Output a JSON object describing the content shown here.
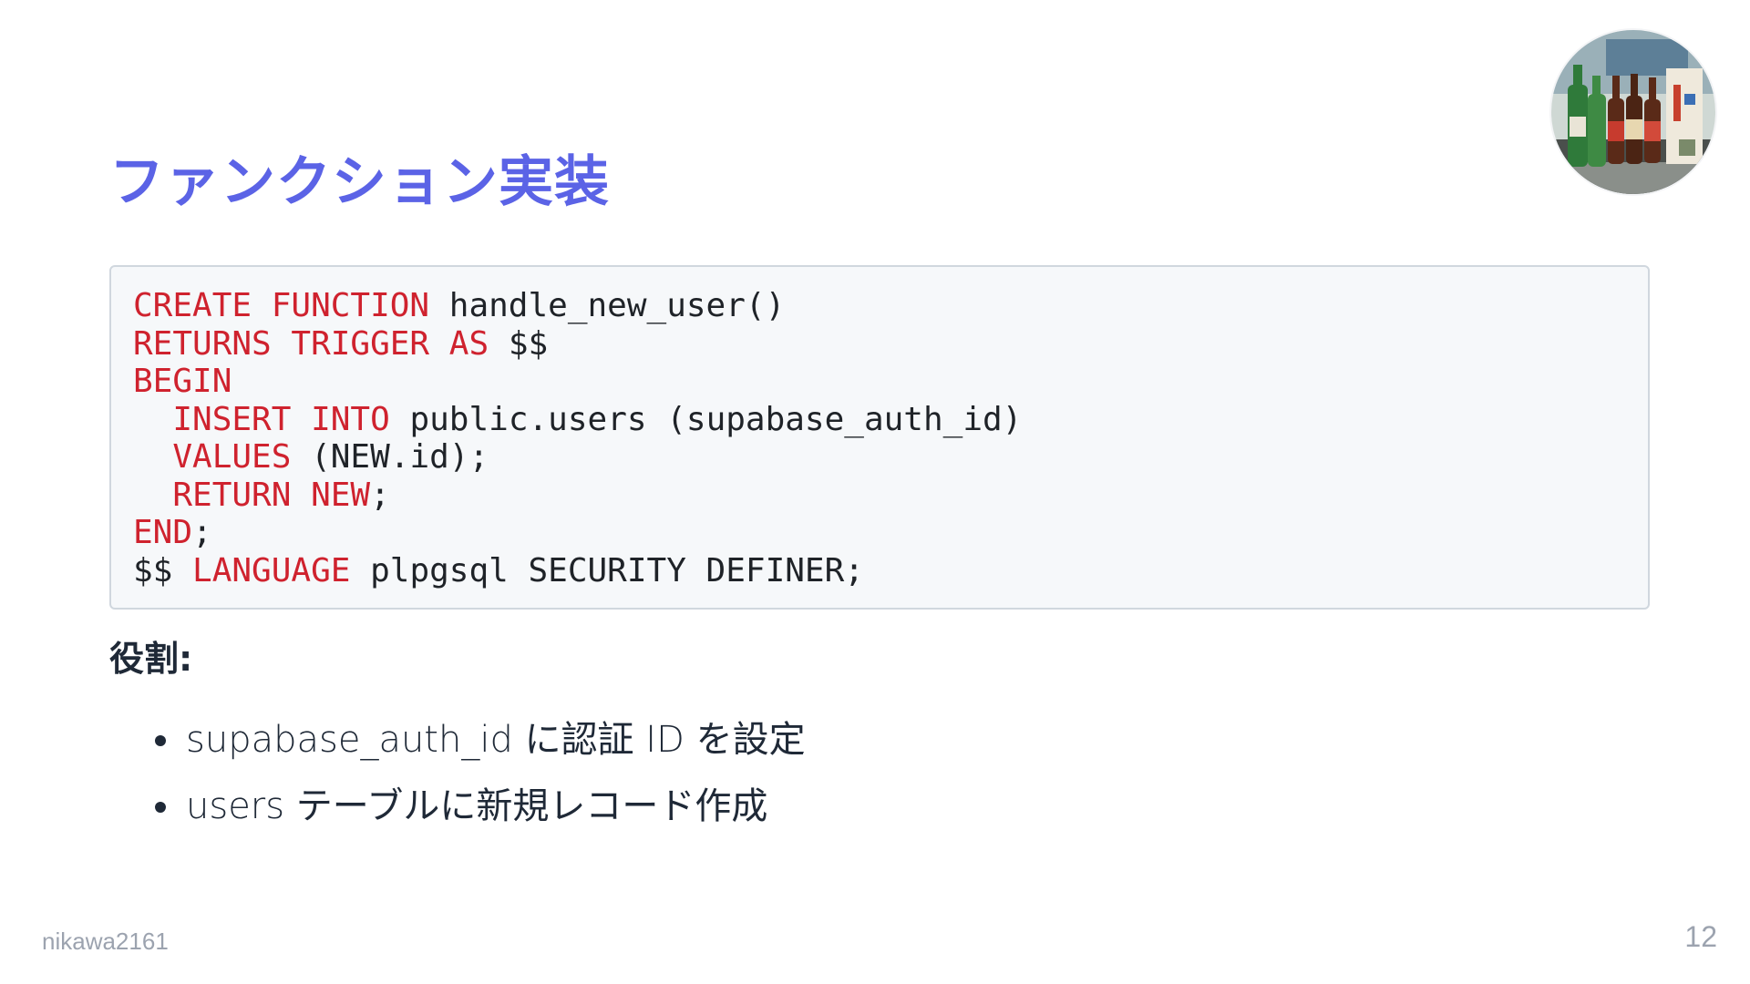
{
  "slide": {
    "title": "ファンクション実装",
    "code_lines": [
      [
        {
          "t": "CREATE FUNCTION",
          "k": true
        },
        {
          "t": " handle_new_user()",
          "k": false
        }
      ],
      [
        {
          "t": "RETURNS TRIGGER AS",
          "k": true
        },
        {
          "t": " $$",
          "k": false
        }
      ],
      [
        {
          "t": "BEGIN",
          "k": true
        }
      ],
      [
        {
          "t": "  ",
          "k": false
        },
        {
          "t": "INSERT INTO",
          "k": true
        },
        {
          "t": " public.users (supabase_auth_id)",
          "k": false
        }
      ],
      [
        {
          "t": "  ",
          "k": false
        },
        {
          "t": "VALUES",
          "k": true
        },
        {
          "t": " (NEW.id);",
          "k": false
        }
      ],
      [
        {
          "t": "  ",
          "k": false
        },
        {
          "t": "RETURN NEW",
          "k": true
        },
        {
          "t": ";",
          "k": false
        }
      ],
      [
        {
          "t": "END",
          "k": true
        },
        {
          "t": ";",
          "k": false
        }
      ],
      [
        {
          "t": "$$ ",
          "k": false
        },
        {
          "t": "LANGUAGE",
          "k": true
        },
        {
          "t": " plpgsql SECURITY DEFINER;",
          "k": false
        }
      ]
    ],
    "role_heading": "役割:",
    "bullets": [
      "supabase_auth_id に認証 ID を設定",
      "users テーブルに新規レコード作成"
    ],
    "author": "nikawa2161",
    "page_number": "12"
  },
  "colors": {
    "title": "#5b63e6",
    "keyword": "#cf222e",
    "code_bg": "#f6f8fa",
    "code_border": "#d0d7de",
    "text": "#1f2937",
    "footer": "#9ca3af"
  },
  "icons": {
    "avatar": "bottles-photo-avatar"
  }
}
